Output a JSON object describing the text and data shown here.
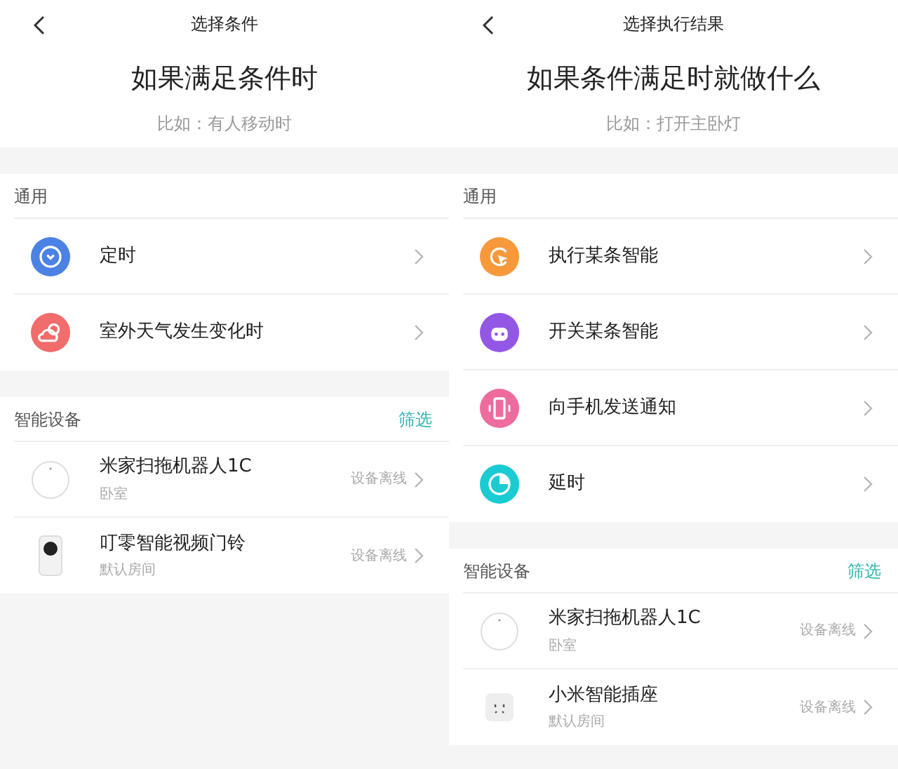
{
  "panels": [
    {
      "nav_title": "选择条件",
      "heading": "如果满足条件时",
      "subtitle": "比如：有人移动时",
      "sections": [
        {
          "title": "通用",
          "items": [
            {
              "kind": "action",
              "color": "#4b82e4",
              "label": "定时"
            },
            {
              "kind": "action",
              "color": "#f16c6b",
              "label": "室外天气发生变化时"
            }
          ]
        },
        {
          "title": "智能设备",
          "filter": "筛选",
          "items": [
            {
              "kind": "device",
              "label": "米家扫拖机器人1C",
              "room": "卧室",
              "status": "设备离线"
            },
            {
              "kind": "device",
              "label": "叮零智能视频门铃",
              "room": "默认房间",
              "status": "设备离线"
            }
          ]
        }
      ]
    },
    {
      "nav_title": "选择执行结果",
      "heading": "如果条件满足时就做什么",
      "subtitle": "比如：打开主卧灯",
      "sections": [
        {
          "title": "通用",
          "items": [
            {
              "kind": "action",
              "color": "#f7993b",
              "label": "执行某条智能"
            },
            {
              "kind": "action",
              "color": "#9357e6",
              "label": "开关某条智能"
            },
            {
              "kind": "action",
              "color": "#ee6b9f",
              "label": "向手机发送通知"
            },
            {
              "kind": "action",
              "color": "#1acbd3",
              "label": "延时"
            }
          ]
        },
        {
          "title": "智能设备",
          "filter": "筛选",
          "items": [
            {
              "kind": "device",
              "label": "米家扫拖机器人1C",
              "room": "卧室",
              "status": "设备离线"
            },
            {
              "kind": "device",
              "label": "小米智能插座",
              "room": "默认房间",
              "status": "设备离线"
            }
          ]
        }
      ]
    }
  ]
}
